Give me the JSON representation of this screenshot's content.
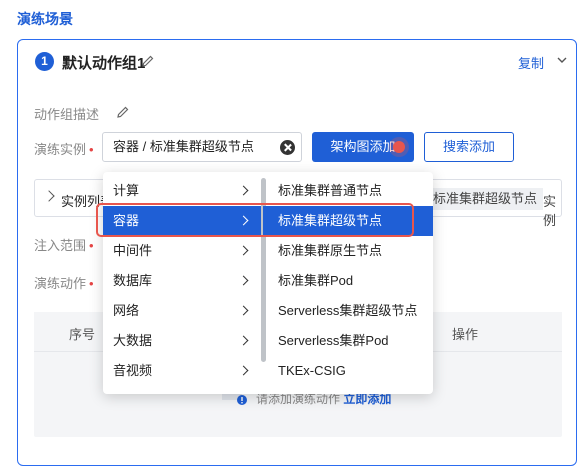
{
  "section_title": "演练场景",
  "group": {
    "number": "1",
    "title": "默认动作组1",
    "copy_label": "复制"
  },
  "fields": {
    "description_label": "动作组描述",
    "instance_label": "演练实例",
    "scope_label": "注入范围",
    "action_label": "演练动作"
  },
  "instance_select": {
    "value": "容器 / 标准集群超级节点"
  },
  "buttons": {
    "architecture": "架构图添加",
    "search_add": "搜索添加"
  },
  "instance_list": {
    "label": "实例列表",
    "tag": "标准集群超级节点",
    "tag2": "实例"
  },
  "table": {
    "headers": [
      "序号",
      "操作"
    ],
    "empty_text": "请添加演练动作",
    "empty_link": "立即添加"
  },
  "cascader": {
    "left": [
      {
        "label": "计算",
        "active": false
      },
      {
        "label": "容器",
        "active": true
      },
      {
        "label": "中间件",
        "active": false
      },
      {
        "label": "数据库",
        "active": false
      },
      {
        "label": "网络",
        "active": false
      },
      {
        "label": "大数据",
        "active": false
      },
      {
        "label": "音视频",
        "active": false
      }
    ],
    "right": [
      {
        "label": "标准集群普通节点",
        "active": false
      },
      {
        "label": "标准集群超级节点",
        "active": true
      },
      {
        "label": "标准集群原生节点",
        "active": false
      },
      {
        "label": "标准集群Pod",
        "active": false
      },
      {
        "label": "Serverless集群超级节点",
        "active": false
      },
      {
        "label": "Serverless集群Pod",
        "active": false
      },
      {
        "label": "TKEx-CSIG",
        "active": false
      }
    ]
  },
  "colors": {
    "primary": "#1f5fd6",
    "highlight": "#e8564d"
  }
}
